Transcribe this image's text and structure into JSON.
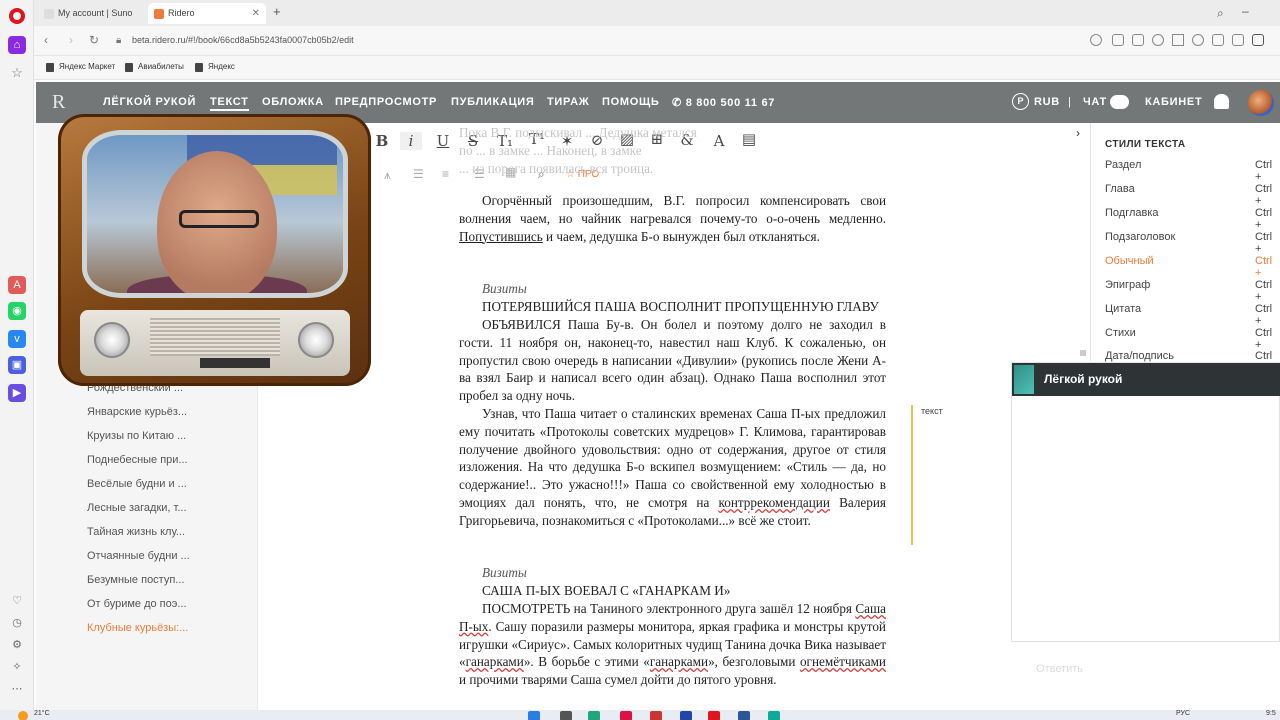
{
  "browser": {
    "tabs": [
      {
        "label": "My account | Suno",
        "active": false
      },
      {
        "label": "Ridero",
        "active": true
      }
    ],
    "new_tab": "+",
    "url": "beta.ridero.ru/#!/book/66cd8a5b5243fa0007cb05b2/edit",
    "bookmarks": [
      "Яндекс Маркет",
      "Авиабилеты",
      "Яндекс"
    ]
  },
  "site_header": {
    "brand": "R",
    "nav": [
      "ЛЁГКОЙ РУКОЙ",
      "ТЕКСТ",
      "ОБЛОЖКА",
      "ПРЕДПРОСМОТР",
      "ПУБЛИКАЦИЯ",
      "ТИРАЖ",
      "ПОМОЩЬ"
    ],
    "phone": "8 800 500 11 67",
    "currency_symbol": "P",
    "currency": "RUB",
    "separator": "|",
    "chat": "ЧАТ",
    "cabinet": "КАБИНЕТ"
  },
  "chapters": [
    {
      "label": "Рождественский ...",
      "active": false
    },
    {
      "label": "Январские курьёз...",
      "active": false
    },
    {
      "label": "Круизы по Китаю ...",
      "active": false
    },
    {
      "label": "Поднебесные при...",
      "active": false
    },
    {
      "label": "Весёлые будни и ...",
      "active": false
    },
    {
      "label": "Лесные загадки, т...",
      "active": false
    },
    {
      "label": "Тайная жизнь клу...",
      "active": false
    },
    {
      "label": "Отчаянные будни ...",
      "active": false
    },
    {
      "label": "Безумные поступ...",
      "active": false
    },
    {
      "label": "От буриме до поэ...",
      "active": false
    },
    {
      "label": "Клубные курьёзы:...",
      "active": true
    }
  ],
  "toolbar": {
    "pro_label": "☆ ПРО"
  },
  "editor": {
    "dim_lines": [
      "Пока В.Г. подыскивал ... Дедушка метался",
      "по ... в замке ... Наконец, в замке",
      "... из порога появилась вся троица."
    ],
    "p1": "Огорчённый произошедшим, В.Г. попросил компенсировать свои волнения чаем, но чайник нагревался почему-то о-о-очень медленно. ",
    "p1_sp": "Попустившись",
    "p1_end": " и чаем, дедушка Б-о вынужден был откланяться.",
    "caption1": "Визиты",
    "heading1": "ПОТЕРЯВШИЙСЯ ПАША ВОСПОЛНИТ ПРОПУЩЕННУЮ ГЛАВУ",
    "p2": "ОБЪЯВИЛСЯ Паша Бу-в. Он болел и поэтому долго не заходил в гости. 11 ноября он, наконец-то, навестил наш Клуб. К сожаленью, он пропустил свою очередь в написании «Дивулии» (рукопись после Жени А-ва взял Баир и написал всего один абзац). Однако Паша восполнил этот пробел за одну ночь.",
    "p3_a": "Узнав, что Паша читает о сталинских временах Саша П-ых предложил ему почитать «Протоколы советских мудрецов» Г. Климова, гарантировав получение двойного удовольствия: одно от содержания, другое от стиля изложения. На что дедушка Б-о вскипел возмущением: «Стиль — да, но содержание!.. Это ужасно!!!» Паша со свойственной ему холодностью в эмоциях дал понять, что, не смотря на ",
    "p3_sp": "контррекомендации",
    "p3_b": " Валерия Григорьевича, познакомиться с «Протоколами...» всё же стоит.",
    "caption2": "Визиты",
    "heading2": "САША П-ЫХ ВОЕВАЛ С «ГАНАРКАМ И»",
    "p4_a": "ПОСМОТРЕТЬ на Таниного электронного друга зашёл 12 ноября ",
    "p4_sp1": "Саша П-ых",
    "p4_b": ". Сашу поразили размеры монитора, яркая графика и монстры крутой игрушки «Сириус». Самых колоритных чудищ Танина дочка Вика называет «",
    "p4_sp2": "ганарками",
    "p4_c": "». В борьбе с этими «",
    "p4_sp3": "ганарками",
    "p4_d": "», безголовыми ",
    "p4_sp4": "огнемётчиками",
    "p4_e": " и прочими тварями Саша сумел дойти до пятого уровня.",
    "margin_label": "текст"
  },
  "styles_panel": {
    "title": "СТИЛИ ТЕКСТА",
    "items": [
      {
        "label": "Раздел",
        "key": "Ctrl +",
        "active": false
      },
      {
        "label": "Глава",
        "key": "Ctrl +",
        "active": false
      },
      {
        "label": "Подглавка",
        "key": "Ctrl +",
        "active": false
      },
      {
        "label": "Подзаголовок",
        "key": "Ctrl +",
        "active": false
      },
      {
        "label": "Обычный",
        "key": "Ctrl +",
        "active": true
      },
      {
        "label": "Эпиграф",
        "key": "Ctrl +",
        "active": false
      },
      {
        "label": "Цитата",
        "key": "Ctrl +",
        "active": false
      },
      {
        "label": "Стихи",
        "key": "Ctrl +",
        "active": false
      },
      {
        "label": "Дата/подпись",
        "key": "Ctrl +",
        "active": false
      }
    ]
  },
  "chat_widget": {
    "title": "Лёгкой рукой",
    "reply_placeholder": "Ответить"
  },
  "taskbar": {
    "weather": "21°C",
    "lang": "РУС",
    "time": "9:5"
  },
  "colors": {
    "accent": "#f07c3b",
    "header_bg": "#737778",
    "chat_header_bg": "#2e3435"
  }
}
